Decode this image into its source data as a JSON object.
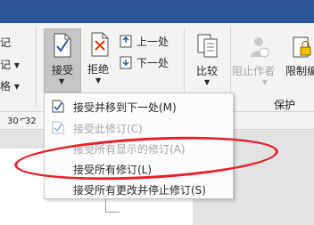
{
  "ribbon": {
    "left_partial": [
      "记",
      "记 ▾",
      "格 ▾"
    ],
    "accept_label": "接受",
    "reject_label": "拒绝",
    "previous_label": "上一处",
    "next_label": "下一处",
    "compare_label": "比较",
    "block_authors_label": "阻止作者",
    "restrict_label": "限制编",
    "protect_group_label": "保护"
  },
  "ruler": {
    "ticks": [
      "30",
      "32"
    ]
  },
  "accept_menu": {
    "items": [
      {
        "label": "接受并移到下一处(M)",
        "enabled": true,
        "icon": "accept-next-icon"
      },
      {
        "label": "接受此修订(C)",
        "enabled": false,
        "icon": "accept-change-icon"
      },
      {
        "label": "接受所有显示的修订(A)",
        "enabled": false,
        "icon": ""
      },
      {
        "label": "接受所有修订(L)",
        "enabled": true,
        "icon": ""
      },
      {
        "label": "接受所有更改并停止修订(S)",
        "enabled": true,
        "icon": ""
      }
    ]
  },
  "colors": {
    "title_bar": "#2b579a",
    "annotation": "#e8202a"
  }
}
